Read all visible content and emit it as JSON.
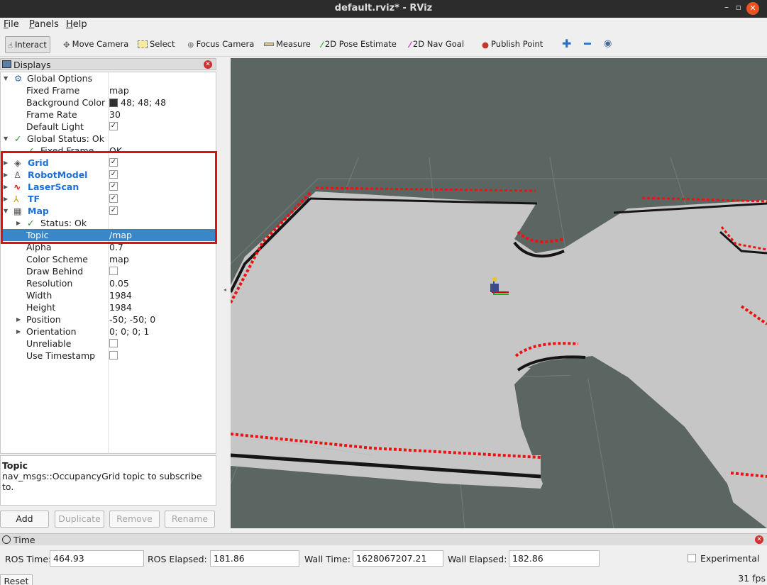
{
  "window": {
    "title": "default.rviz* - RViz"
  },
  "menu": [
    {
      "label": "File",
      "key": "F",
      "rest": "ile"
    },
    {
      "label": "Panels",
      "key": "P",
      "rest": "anels"
    },
    {
      "label": "Help",
      "key": "H",
      "rest": "elp"
    }
  ],
  "toolbar": {
    "interact": "Interact",
    "move_camera": "Move Camera",
    "select": "Select",
    "focus_camera": "Focus Camera",
    "measure": "Measure",
    "pose_estimate": "2D Pose Estimate",
    "nav_goal": "2D Nav Goal",
    "publish_point": "Publish Point"
  },
  "displays": {
    "title": "Displays",
    "global_options": "Global Options",
    "fixed_frame": {
      "label": "Fixed Frame",
      "value": "map"
    },
    "background_color": {
      "label": "Background Color",
      "value": "48; 48; 48",
      "color": "#303030"
    },
    "frame_rate": {
      "label": "Frame Rate",
      "value": "30"
    },
    "default_light": {
      "label": "Default Light",
      "checked": true
    },
    "global_status": "Global Status: Ok",
    "fixed_frame_status": {
      "label": "Fixed Frame",
      "value": "OK"
    },
    "items": [
      {
        "label": "Grid",
        "checked": true,
        "icon": "grid-icon"
      },
      {
        "label": "RobotModel",
        "checked": true,
        "icon": "robot-icon"
      },
      {
        "label": "LaserScan",
        "checked": true,
        "icon": "laser-icon"
      },
      {
        "label": "TF",
        "checked": true,
        "icon": "tf-icon"
      },
      {
        "label": "Map",
        "checked": true,
        "icon": "map-icon"
      }
    ],
    "map_props": {
      "status": "Status: Ok",
      "topic": {
        "label": "Topic",
        "value": "/map"
      },
      "alpha": {
        "label": "Alpha",
        "value": "0.7"
      },
      "color_scheme": {
        "label": "Color Scheme",
        "value": "map"
      },
      "draw_behind": {
        "label": "Draw Behind",
        "checked": false
      },
      "resolution": {
        "label": "Resolution",
        "value": "0.05"
      },
      "width": {
        "label": "Width",
        "value": "1984"
      },
      "height": {
        "label": "Height",
        "value": "1984"
      },
      "position": {
        "label": "Position",
        "value": "-50; -50; 0"
      },
      "orientation": {
        "label": "Orientation",
        "value": "0; 0; 0; 1"
      },
      "unreliable": {
        "label": "Unreliable",
        "checked": false
      },
      "use_timestamp": {
        "label": "Use Timestamp",
        "checked": false
      }
    }
  },
  "description": {
    "title": "Topic",
    "text": "nav_msgs::OccupancyGrid topic to subscribe to."
  },
  "buttons": {
    "add": "Add",
    "duplicate": "Duplicate",
    "remove": "Remove",
    "rename": "Rename"
  },
  "time": {
    "title": "Time",
    "ros_time": {
      "label": "ROS Time:",
      "value": "464.93"
    },
    "ros_elapsed": {
      "label": "ROS Elapsed:",
      "value": "181.86"
    },
    "wall_time": {
      "label": "Wall Time:",
      "value": "1628067207.21"
    },
    "wall_elapsed": {
      "label": "Wall Elapsed:",
      "value": "182.86"
    },
    "experimental": "Experimental",
    "reset": "Reset",
    "fps": "31 fps"
  },
  "colors": {
    "selection": "#3a87c8",
    "highlight_box": "#e01010",
    "laser": "#ee1111",
    "viewport_bg": "#5b6662"
  }
}
